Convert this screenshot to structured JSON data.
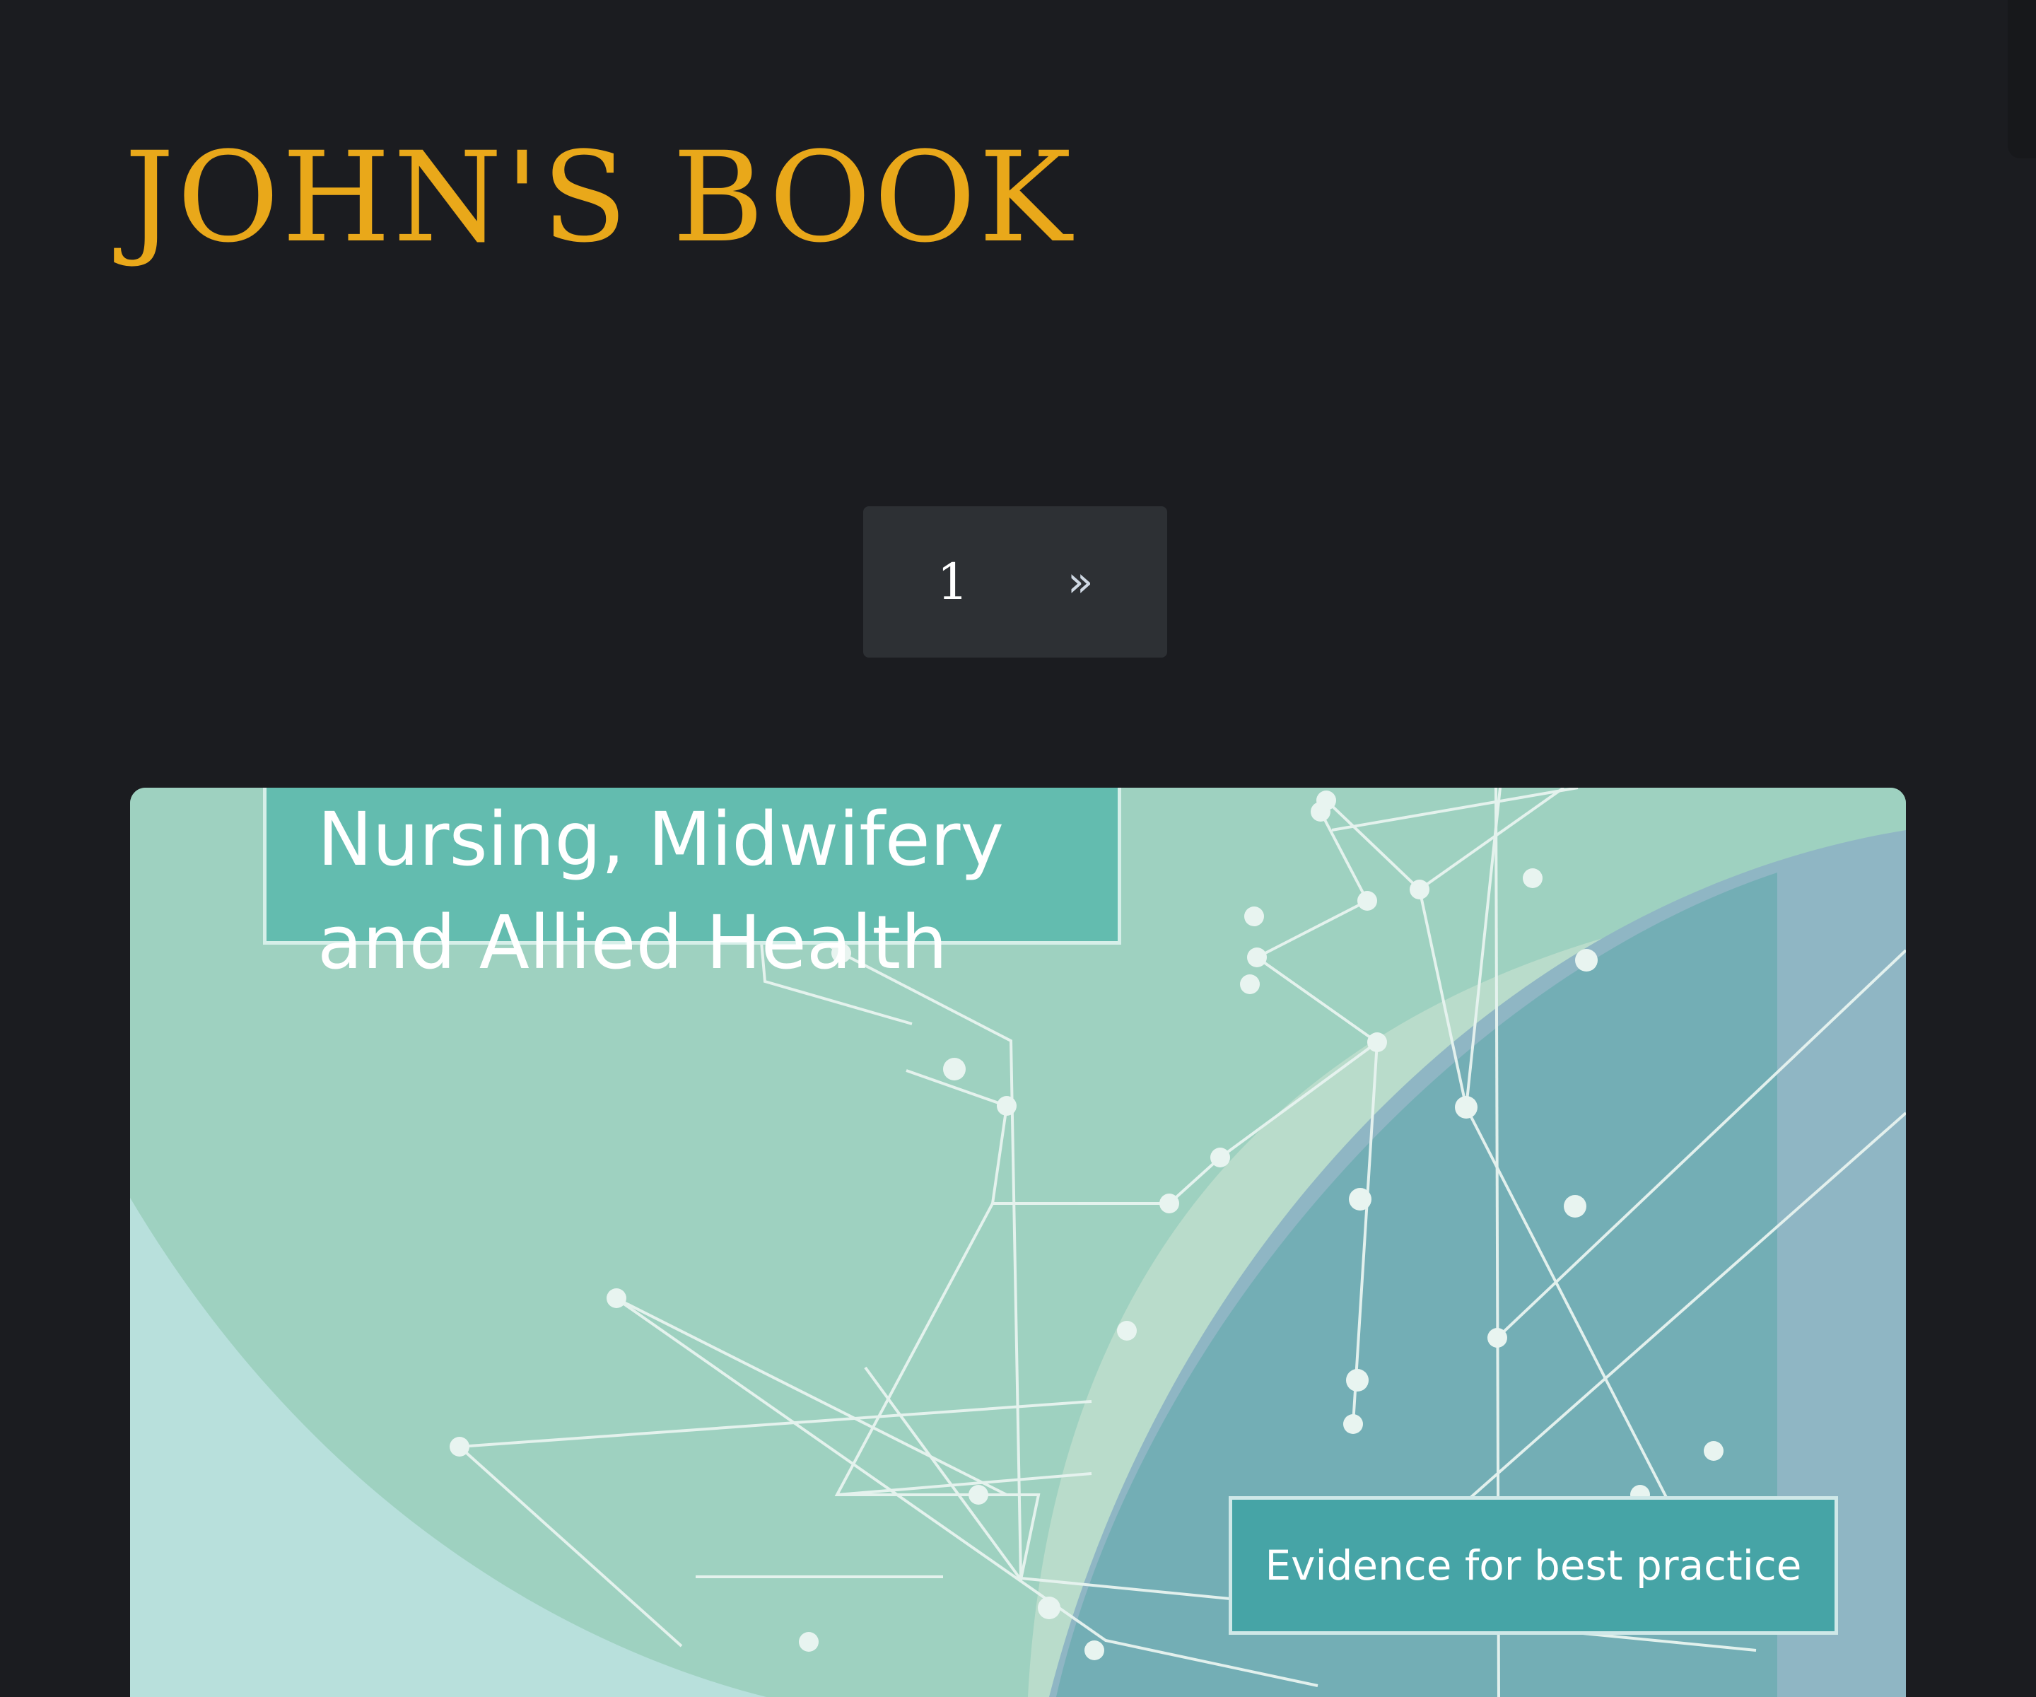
{
  "site": {
    "title": "JOHN'S BOOK",
    "title_color": "#e9a81a",
    "background_color": "#1b1c20"
  },
  "pagination": {
    "current_page": "1",
    "next_label": "»"
  },
  "book": {
    "cover_title_line1": "Nursing, Midwifery",
    "cover_title_line2": "and Allied Health",
    "cover_tagline": "Evidence for best practice"
  }
}
